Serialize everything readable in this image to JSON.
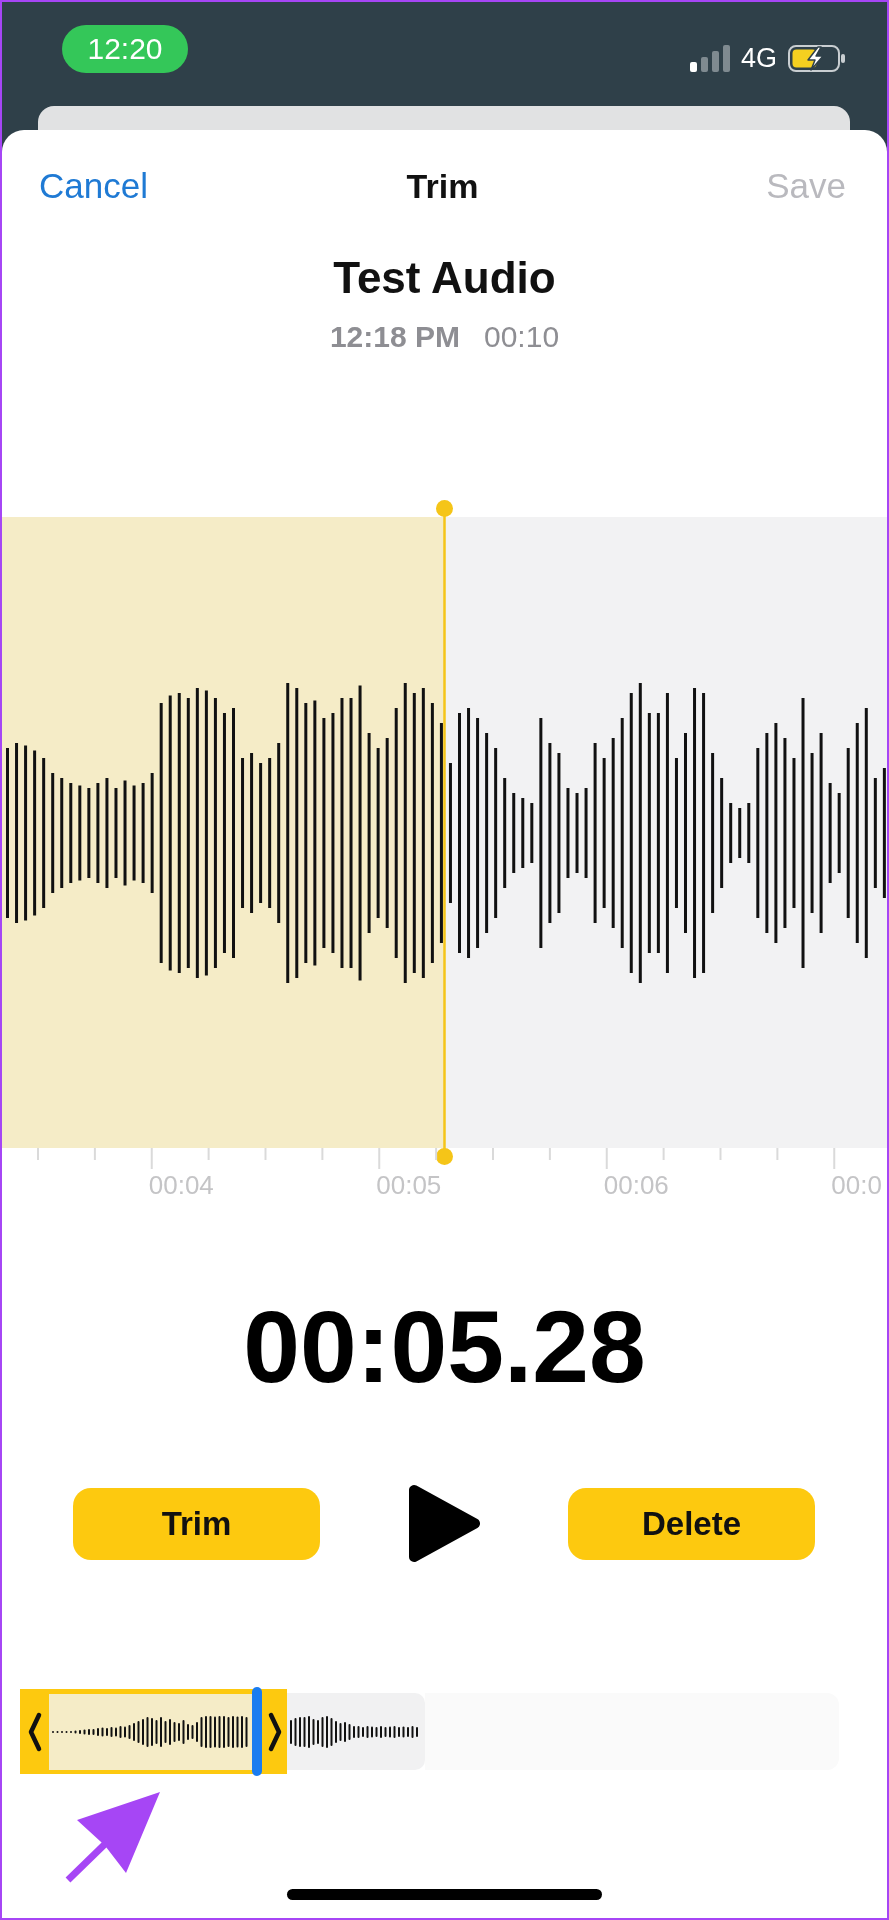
{
  "status_bar": {
    "time": "12:20",
    "network": "4G"
  },
  "nav": {
    "cancel": "Cancel",
    "title": "Trim",
    "save": {
      "label": "Save",
      "disabled": true
    }
  },
  "recording": {
    "title": "Test Audio",
    "time": "12:18 PM",
    "duration": "00:10"
  },
  "timeline": {
    "labels": [
      "00:04",
      "00:05",
      "00:06",
      "00:0"
    ]
  },
  "current_time": "00:05.28",
  "buttons": [
    {
      "label": "Trim"
    },
    {
      "label": "Delete"
    }
  ]
}
